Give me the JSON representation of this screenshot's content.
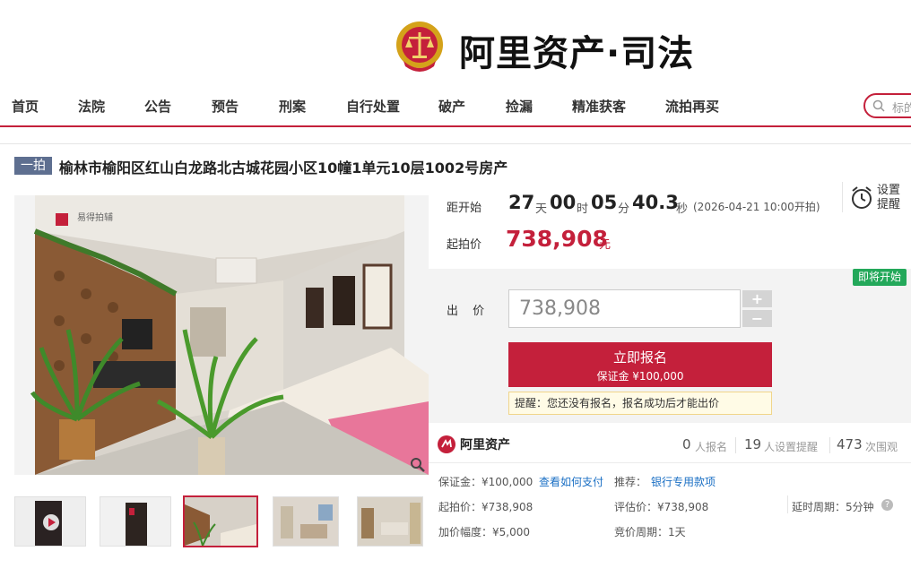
{
  "brand": {
    "logo_text": "阿里资产·司法"
  },
  "nav": {
    "items": [
      "首页",
      "法院",
      "公告",
      "预告",
      "刑案",
      "自行处置",
      "破产",
      "捡漏",
      "精准获客",
      "流拍再买"
    ],
    "search_placeholder": "标的"
  },
  "listing": {
    "badge": "一拍",
    "title": "榆林市榆阳区红山白龙路北古城花园小区10幢1单元10层1002号房产"
  },
  "countdown": {
    "label": "距开始",
    "days": "27",
    "days_unit": "天",
    "hours": "00",
    "hours_unit": "时",
    "minutes": "05",
    "minutes_unit": "分",
    "seconds": "40.3",
    "seconds_unit": "秒",
    "start_time": "(2026-04-21 10:00开拍)"
  },
  "reminder": {
    "label": "设置提醒"
  },
  "start_price": {
    "label": "起拍价",
    "value": "738,908",
    "unit": "元"
  },
  "status_tag": "即将开始",
  "bid": {
    "label": "出 价",
    "value": "738,908",
    "plus": "+",
    "minus": "−",
    "signup_label": "立即报名",
    "deposit_label": "保证金 ¥100,000",
    "tip": "提醒：您还没有报名，报名成功后才能出价"
  },
  "stats": {
    "brand": "阿里资产",
    "signups": "0",
    "signups_unit": "人报名",
    "reminders": "19",
    "reminders_unit": "人设置提醒",
    "views": "473",
    "views_unit": "次围观"
  },
  "details": {
    "deposit": "保证金：¥100,000",
    "how_to_pay": "查看如何支付",
    "recommend_label": "推荐：",
    "recommend_link": "银行专用款项",
    "start_price": "起拍价：¥738,908",
    "appraisal": "评估价：¥738,908",
    "delay": "延时周期：5分钟",
    "increment": "加价幅度：¥5,000",
    "cycle": "竞价周期：1天"
  },
  "photo": {
    "watermark": "易得拍辅"
  },
  "colors": {
    "accent": "#c4203b",
    "badge": "#5e6f90",
    "green": "#23a85a",
    "link": "#1a6fc4"
  }
}
